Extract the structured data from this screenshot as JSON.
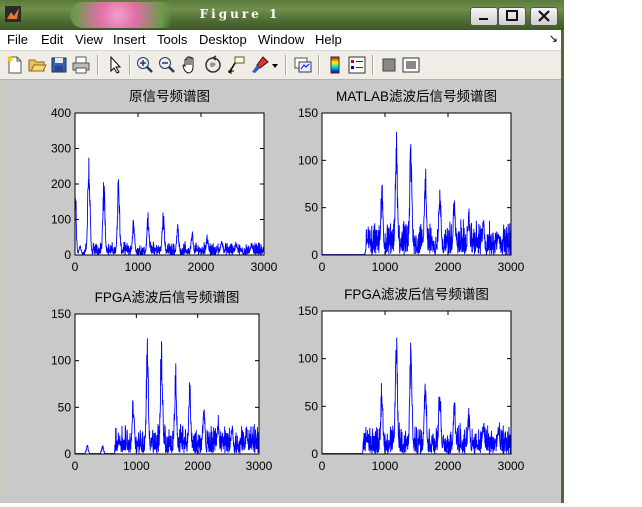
{
  "window": {
    "title": "Figure 1",
    "controls": [
      "minimize",
      "maximize",
      "close"
    ]
  },
  "menu": {
    "items": [
      "File",
      "Edit",
      "View",
      "Insert",
      "Tools",
      "Desktop",
      "Window",
      "Help"
    ],
    "dock_arrow": "↘"
  },
  "toolbar": {
    "icons": [
      "new-figure-icon",
      "open-file-icon",
      "save-icon",
      "print-icon",
      "edit-plot-arrow-icon",
      "zoom-in-icon",
      "zoom-out-icon",
      "pan-hand-icon",
      "rotate-3d-icon",
      "data-cursor-icon",
      "brush-icon",
      "brush-dropdown-icon",
      "link-plot-icon",
      "insert-colorbar-icon",
      "insert-legend-icon",
      "hide-plot-tools-icon",
      "show-plot-tools-icon"
    ]
  },
  "chart_data": [
    {
      "type": "line",
      "title": "原信号频谱图",
      "xlim": [
        0,
        3000
      ],
      "ylim": [
        0,
        400
      ],
      "xticks": [
        "0",
        "1000",
        "2000",
        "3000"
      ],
      "yticks": [
        "0",
        "100",
        "200",
        "300",
        "400"
      ],
      "color": "#0000ff",
      "grid": false,
      "peaks": [
        {
          "x": 0,
          "y": 180
        },
        {
          "x": 80,
          "y": 30
        },
        {
          "x": 220,
          "y": 315
        },
        {
          "x": 460,
          "y": 220
        },
        {
          "x": 690,
          "y": 235
        },
        {
          "x": 930,
          "y": 110
        },
        {
          "x": 1160,
          "y": 125
        },
        {
          "x": 1400,
          "y": 130
        },
        {
          "x": 1630,
          "y": 90
        },
        {
          "x": 1860,
          "y": 70
        },
        {
          "x": 2100,
          "y": 60
        },
        {
          "x": 2330,
          "y": 50
        },
        {
          "x": 2560,
          "y": 40
        },
        {
          "x": 2800,
          "y": 35
        }
      ],
      "noise_floor": [
        0,
        40
      ],
      "signal_start_x": 150
    },
    {
      "type": "line",
      "title": "MATLAB滤波后信号频谱图",
      "xlim": [
        0,
        3000
      ],
      "ylim": [
        0,
        150
      ],
      "xticks": [
        "0",
        "1000",
        "2000",
        "3000"
      ],
      "yticks": [
        "0",
        "50",
        "100",
        "150"
      ],
      "color": "#0000ff",
      "grid": false,
      "peaks": [
        {
          "x": 720,
          "y": 20
        },
        {
          "x": 950,
          "y": 80
        },
        {
          "x": 1180,
          "y": 135
        },
        {
          "x": 1410,
          "y": 130
        },
        {
          "x": 1640,
          "y": 100
        },
        {
          "x": 1870,
          "y": 85
        },
        {
          "x": 2100,
          "y": 65
        },
        {
          "x": 2330,
          "y": 50
        },
        {
          "x": 2560,
          "y": 40
        },
        {
          "x": 2800,
          "y": 30
        }
      ],
      "noise_floor": [
        0,
        40
      ],
      "signal_start_x": 700
    },
    {
      "type": "line",
      "title": "FPGA滤波后信号频谱图",
      "xlim": [
        0,
        3000
      ],
      "ylim": [
        0,
        150
      ],
      "xticks": [
        "0",
        "1000",
        "2000",
        "3000"
      ],
      "yticks": [
        "0",
        "50",
        "100",
        "150"
      ],
      "color": "#0000ff",
      "grid": false,
      "peaks": [
        {
          "x": 200,
          "y": 10
        },
        {
          "x": 450,
          "y": 10
        },
        {
          "x": 720,
          "y": 20
        },
        {
          "x": 950,
          "y": 70
        },
        {
          "x": 1180,
          "y": 130
        },
        {
          "x": 1410,
          "y": 140
        },
        {
          "x": 1640,
          "y": 100
        },
        {
          "x": 1870,
          "y": 80
        },
        {
          "x": 2100,
          "y": 60
        },
        {
          "x": 2330,
          "y": 45
        },
        {
          "x": 2560,
          "y": 35
        },
        {
          "x": 2800,
          "y": 30
        }
      ],
      "noise_floor": [
        0,
        35
      ],
      "signal_start_x": 650
    },
    {
      "type": "line",
      "title": "FPGA滤波后信号频谱图",
      "xlim": [
        0,
        3000
      ],
      "ylim": [
        0,
        150
      ],
      "xticks": [
        "0",
        "1000",
        "2000",
        "3000"
      ],
      "yticks": [
        "0",
        "50",
        "100",
        "150"
      ],
      "color": "#0000ff",
      "grid": false,
      "peaks": [
        {
          "x": 720,
          "y": 20
        },
        {
          "x": 950,
          "y": 80
        },
        {
          "x": 1180,
          "y": 135
        },
        {
          "x": 1410,
          "y": 130
        },
        {
          "x": 1640,
          "y": 100
        },
        {
          "x": 1870,
          "y": 85
        },
        {
          "x": 2100,
          "y": 65
        },
        {
          "x": 2330,
          "y": 50
        },
        {
          "x": 2560,
          "y": 40
        },
        {
          "x": 2800,
          "y": 30
        }
      ],
      "noise_floor": [
        0,
        35
      ],
      "signal_start_x": 650
    }
  ]
}
